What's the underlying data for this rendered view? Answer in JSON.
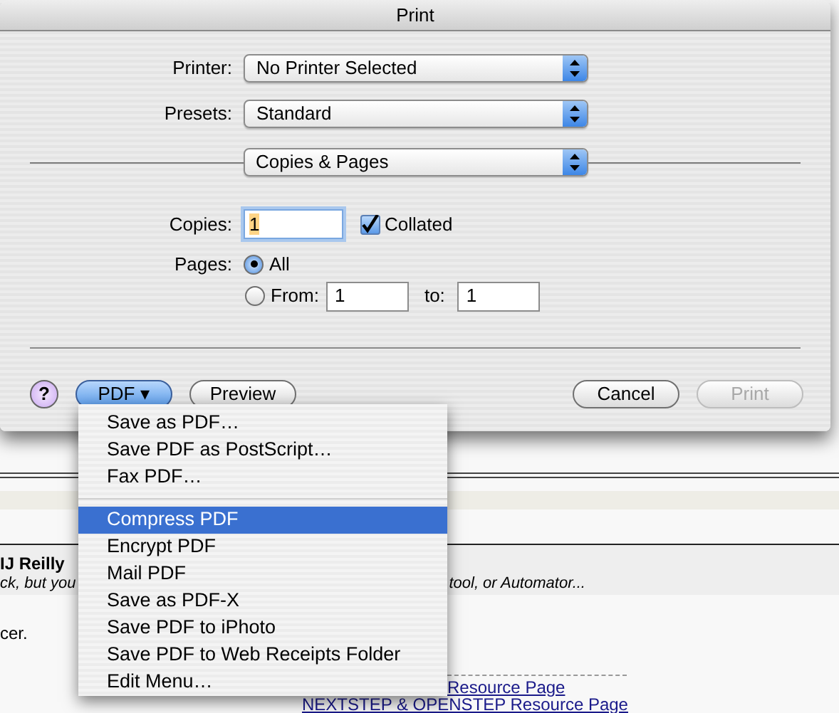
{
  "window": {
    "title": "Print"
  },
  "printer": {
    "label": "Printer:",
    "value": "No Printer Selected"
  },
  "presets": {
    "label": "Presets:",
    "value": "Standard"
  },
  "pane": {
    "value": "Copies & Pages"
  },
  "copies": {
    "label": "Copies:",
    "value": "1",
    "collated": {
      "label": "Collated",
      "checked": true
    }
  },
  "pages": {
    "label": "Pages:",
    "options": [
      {
        "label": "All",
        "selected": true
      },
      {
        "label": "From:",
        "selected": false
      }
    ],
    "from": "1",
    "to_label": "to:",
    "to": "1"
  },
  "buttons": [
    {
      "label": "?",
      "kind": "help",
      "disabled": false
    },
    {
      "label": "PDF ▾",
      "kind": "menu",
      "disabled": false
    },
    {
      "label": "Preview",
      "kind": "normal",
      "disabled": false
    },
    {
      "label": "Cancel",
      "kind": "normal",
      "disabled": false
    },
    {
      "label": "Print",
      "kind": "normal",
      "disabled": true
    }
  ],
  "menu": [
    {
      "kind": "item",
      "label": "Save as PDF…",
      "selected": false
    },
    {
      "kind": "item",
      "label": "Save PDF as PostScript…",
      "selected": false
    },
    {
      "kind": "item",
      "label": "Fax PDF…",
      "selected": false
    },
    {
      "kind": "separator"
    },
    {
      "kind": "item",
      "label": "Compress PDF",
      "selected": true
    },
    {
      "kind": "item",
      "label": "Encrypt PDF",
      "selected": false
    },
    {
      "kind": "item",
      "label": "Mail PDF",
      "selected": false
    },
    {
      "kind": "item",
      "label": "Save as PDF-X",
      "selected": false
    },
    {
      "kind": "item",
      "label": "Save PDF to iPhoto",
      "selected": false
    },
    {
      "kind": "item",
      "label": "Save PDF to Web Receipts Folder",
      "selected": false
    },
    {
      "kind": "item",
      "label": "Edit Menu…",
      "selected": false
    }
  ],
  "background_page": {
    "author": "IJ Reilly",
    "excerpt_start": "ck, but you",
    "excerpt_end": "tool, or Automator...",
    "text": "cer.",
    "links": [
      "Resource Page",
      "NEXTSTEP & OPENSTEP Resource Page"
    ]
  }
}
